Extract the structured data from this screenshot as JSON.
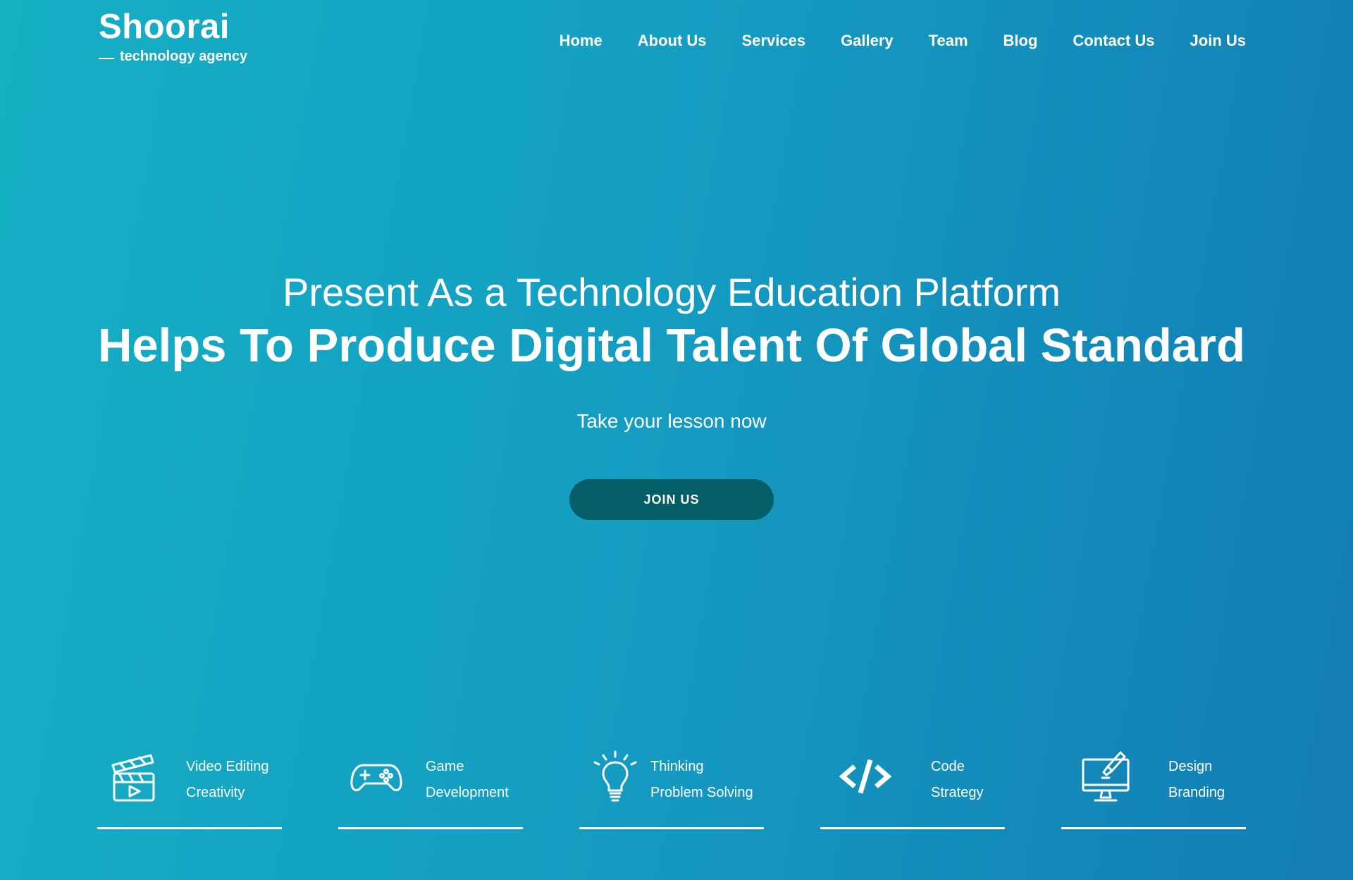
{
  "brand": {
    "name": "Shoorai",
    "tagline": "technology agency"
  },
  "nav": {
    "items": [
      {
        "label": "Home"
      },
      {
        "label": "About Us"
      },
      {
        "label": "Services"
      },
      {
        "label": "Gallery"
      },
      {
        "label": "Team"
      },
      {
        "label": "Blog"
      },
      {
        "label": "Contact Us"
      },
      {
        "label": "Join Us"
      }
    ]
  },
  "hero": {
    "subtitle": "Present As a Technology Education Platform",
    "title": "Helps To Produce Digital Talent Of Global Standard",
    "lesson": "Take your lesson now",
    "cta": "JOIN US"
  },
  "features": [
    {
      "icon": "clapperboard-icon",
      "line1": "Video Editing",
      "line2": "Creativity"
    },
    {
      "icon": "gamepad-icon",
      "line1": "Game",
      "line2": "Development"
    },
    {
      "icon": "lightbulb-icon",
      "line1": "Thinking",
      "line2": "Problem Solving"
    },
    {
      "icon": "code-icon",
      "line1": "Code",
      "line2": "Strategy"
    },
    {
      "icon": "monitor-design-icon",
      "line1": "Design",
      "line2": "Branding"
    }
  ],
  "colors": {
    "gradient_start": "#15b0c4",
    "gradient_end": "#127cb4",
    "button_bg": "#035e67",
    "text": "#ffffff"
  }
}
